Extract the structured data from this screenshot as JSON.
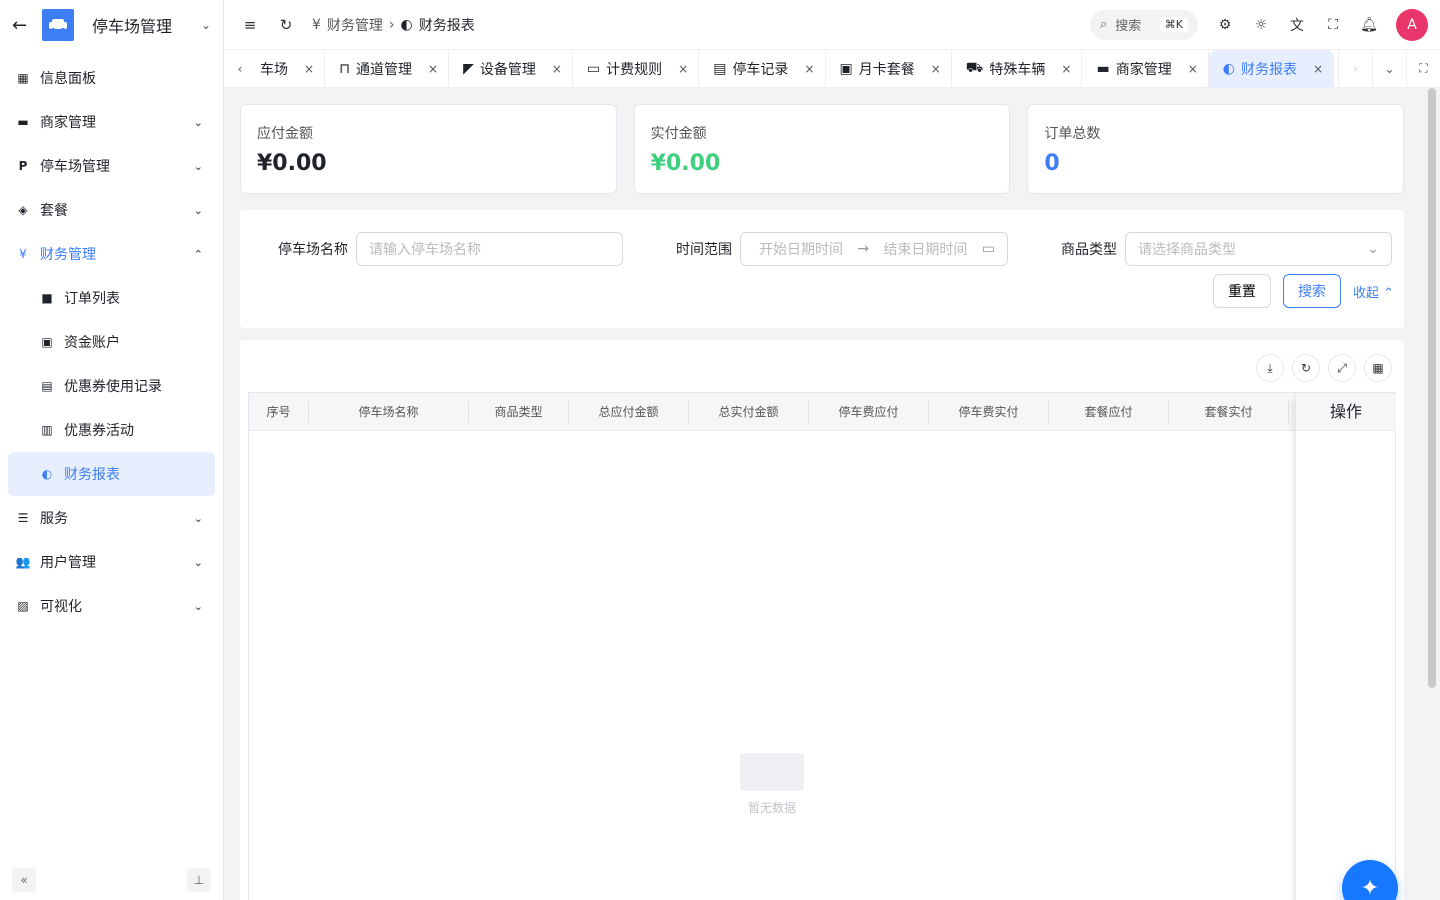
{
  "sidebar": {
    "title": "停车场管理",
    "items": [
      {
        "label": "信息面板",
        "icon": "dashboard-icon"
      },
      {
        "label": "商家管理",
        "icon": "store-icon"
      },
      {
        "label": "停车场管理",
        "icon": "parking-icon"
      },
      {
        "label": "套餐",
        "icon": "package-icon"
      },
      {
        "label": "财务管理",
        "icon": "yen-icon"
      },
      {
        "label": "订单列表",
        "icon": "order-icon"
      },
      {
        "label": "资金账户",
        "icon": "wallet-icon"
      },
      {
        "label": "优惠券使用记录",
        "icon": "coupon-icon"
      },
      {
        "label": "优惠券活动",
        "icon": "coupon-activity-icon"
      },
      {
        "label": "财务报表",
        "icon": "report-icon"
      },
      {
        "label": "服务",
        "icon": "service-icon"
      },
      {
        "label": "用户管理",
        "icon": "users-icon"
      },
      {
        "label": "可视化",
        "icon": "chart-icon"
      }
    ]
  },
  "header": {
    "breadcrumb_parent": "财务管理",
    "breadcrumb_current": "财务报表",
    "search_label": "搜索",
    "search_shortcut": "⌘K",
    "avatar_initial": "A"
  },
  "tabs": [
    {
      "label": "车场"
    },
    {
      "label": "通道管理"
    },
    {
      "label": "设备管理"
    },
    {
      "label": "计费规则"
    },
    {
      "label": "停车记录"
    },
    {
      "label": "月卡套餐"
    },
    {
      "label": "特殊车辆"
    },
    {
      "label": "商家管理"
    },
    {
      "label": "财务报表"
    }
  ],
  "stats": [
    {
      "title": "应付金额",
      "value": "¥0.00",
      "color": "#1f2329"
    },
    {
      "title": "实付金额",
      "value": "¥0.00",
      "color": "#3ecf7f"
    },
    {
      "title": "订单总数",
      "value": "0",
      "color": "#3d7ef5"
    }
  ],
  "filter": {
    "parking_label": "停车场名称",
    "parking_placeholder": "请输入停车场名称",
    "time_label": "时间范围",
    "start_placeholder": "开始日期时间",
    "end_placeholder": "结束日期时间",
    "type_label": "商品类型",
    "type_placeholder": "请选择商品类型",
    "reset_label": "重置",
    "search_label": "搜索",
    "collapse_label": "收起"
  },
  "table": {
    "columns": [
      "序号",
      "停车场名称",
      "商品类型",
      "总应付金额",
      "总实付金额",
      "停车费应付",
      "停车费实付",
      "套餐应付",
      "套餐实付"
    ],
    "action_column": "操作",
    "empty_text": "暂无数据"
  }
}
